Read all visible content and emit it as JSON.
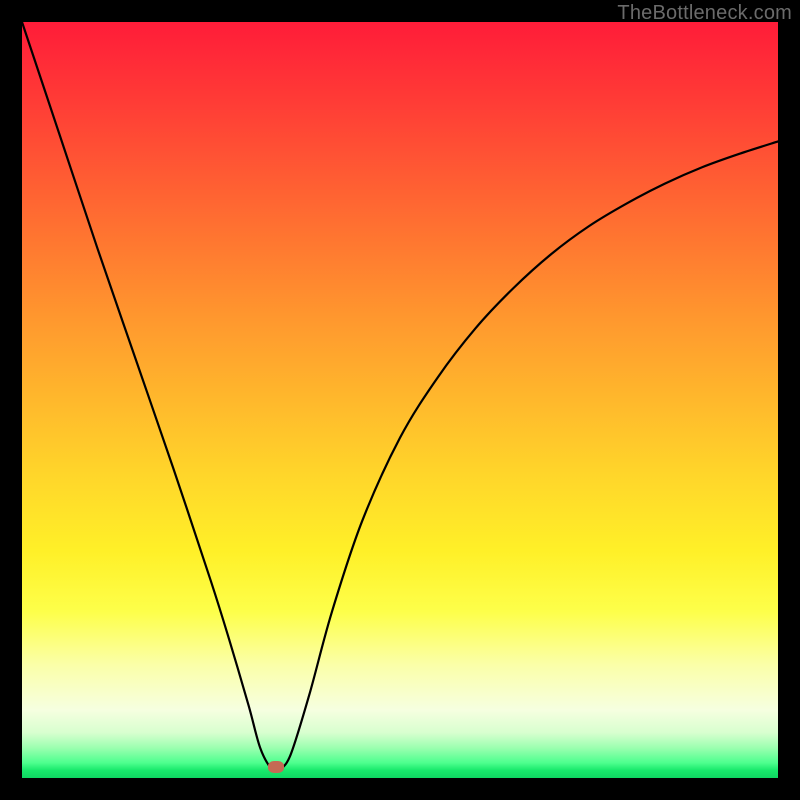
{
  "watermark": "TheBottleneck.com",
  "marker": {
    "x_frac": 0.336,
    "y_frac": 0.986
  },
  "chart_data": {
    "type": "line",
    "title": "",
    "xlabel": "",
    "ylabel": "",
    "xlim": [
      0,
      1
    ],
    "ylim": [
      0,
      1
    ],
    "series": [
      {
        "name": "bottleneck-curve",
        "x": [
          0.0,
          0.05,
          0.1,
          0.15,
          0.2,
          0.25,
          0.275,
          0.3,
          0.315,
          0.33,
          0.34,
          0.355,
          0.38,
          0.41,
          0.45,
          0.5,
          0.55,
          0.6,
          0.65,
          0.7,
          0.75,
          0.8,
          0.85,
          0.9,
          0.95,
          1.0
        ],
        "y": [
          1.0,
          0.85,
          0.7,
          0.555,
          0.41,
          0.26,
          0.18,
          0.095,
          0.04,
          0.012,
          0.01,
          0.03,
          0.11,
          0.22,
          0.34,
          0.45,
          0.53,
          0.595,
          0.648,
          0.693,
          0.73,
          0.76,
          0.786,
          0.808,
          0.826,
          0.842
        ]
      }
    ],
    "marker_point": {
      "x": 0.336,
      "y": 0.014
    },
    "background_gradient": {
      "stops": [
        {
          "pos": 0.0,
          "color": "#ff1c39"
        },
        {
          "pos": 0.5,
          "color": "#ffb82c"
        },
        {
          "pos": 0.78,
          "color": "#fdff4a"
        },
        {
          "pos": 0.94,
          "color": "#d8ffcf"
        },
        {
          "pos": 1.0,
          "color": "#0fd662"
        }
      ]
    }
  }
}
